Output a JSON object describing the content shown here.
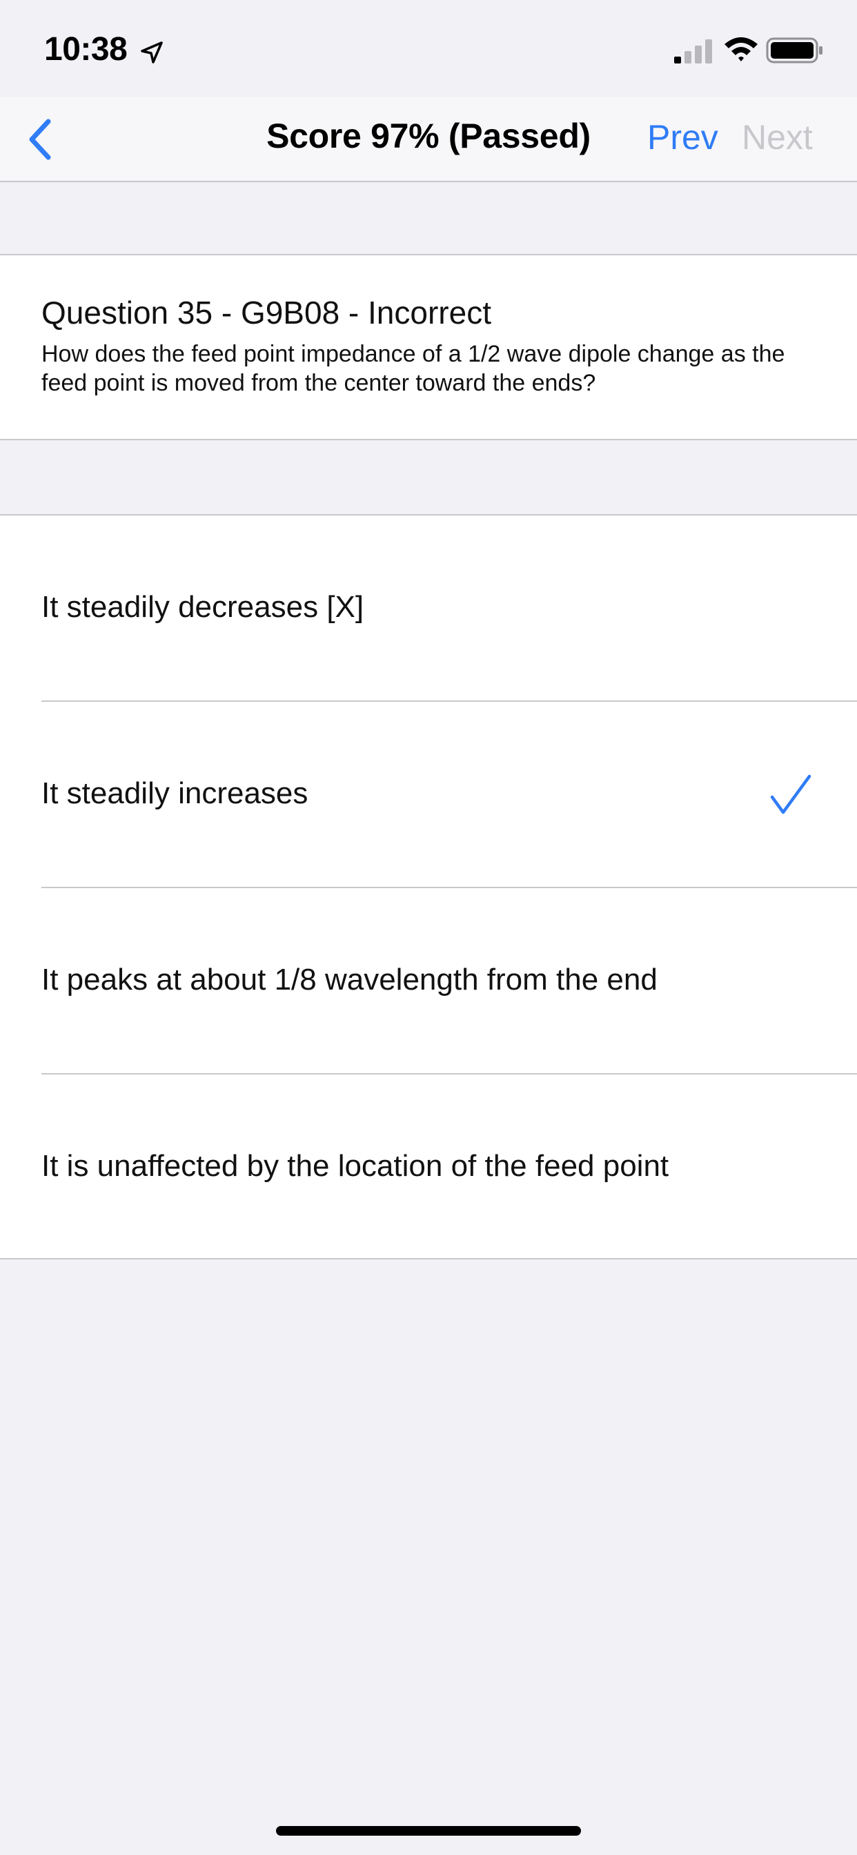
{
  "status_bar": {
    "time": "10:38",
    "icons": [
      "location-arrow-icon",
      "cellular-signal-icon",
      "wifi-icon",
      "battery-icon"
    ]
  },
  "nav": {
    "title": "Score 97% (Passed)",
    "prev_label": "Prev",
    "next_label": "Next",
    "back_icon": "chevron-left-icon"
  },
  "question": {
    "heading": "Question 35 - G9B08 - Incorrect",
    "text": "How does the feed point impedance of a 1/2 wave dipole change as the feed point is moved from the center toward the ends?"
  },
  "answers": [
    {
      "label": "It steadily decreases [X]",
      "correct": false
    },
    {
      "label": "It steadily increases",
      "correct": true
    },
    {
      "label": "It peaks at about 1/8 wavelength from the end",
      "correct": false
    },
    {
      "label": "It is unaffected by the location of the feed point",
      "correct": false
    }
  ],
  "colors": {
    "accent": "#2f7cf6",
    "disabled": "#c8c8cc",
    "background": "#f1f1f6"
  }
}
